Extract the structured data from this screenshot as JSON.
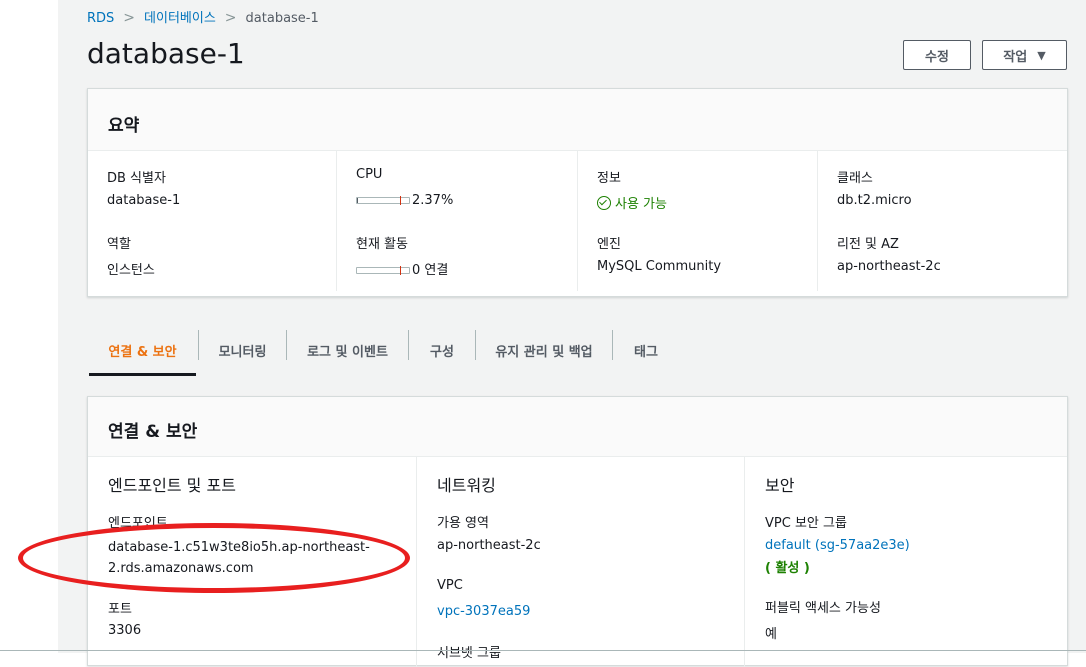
{
  "breadcrumb": {
    "root": "RDS",
    "parent": "데이터베이스",
    "current": "database-1"
  },
  "page": {
    "title": "database-1"
  },
  "actions": {
    "edit_label": "수정",
    "actions_label": "작업",
    "actions_caret": "▼"
  },
  "summary": {
    "title": "요약",
    "db_identifier": {
      "label": "DB 식별자",
      "value": "database-1"
    },
    "cpu": {
      "label": "CPU",
      "value": "2.37%",
      "meter_fraction": 0.0237
    },
    "info": {
      "label": "정보",
      "value": "사용 가능"
    },
    "class": {
      "label": "클래스",
      "value": "db.t2.micro"
    },
    "role": {
      "label": "역할",
      "value": "인스턴스"
    },
    "activity": {
      "label": "현재 활동",
      "value": "0 연결",
      "meter_fraction": 0
    },
    "engine": {
      "label": "엔진",
      "value": "MySQL Community"
    },
    "region": {
      "label": "리전 및 AZ",
      "value": "ap-northeast-2c"
    }
  },
  "tabs": [
    {
      "label": "연결 & 보안",
      "active": true
    },
    {
      "label": "모니터링"
    },
    {
      "label": "로그 및 이벤트"
    },
    {
      "label": "구성"
    },
    {
      "label": "유지 관리 및 백업"
    },
    {
      "label": "태그"
    }
  ],
  "connectivity": {
    "title": "연결 & 보안",
    "endpoint_section": {
      "title": "엔드포인트 및 포트",
      "endpoint_label": "엔드포인트",
      "endpoint_value": "database-1.c51w3te8io5h.ap-northeast-2.rds.amazonaws.com",
      "endpoint_line1": "database-1.c51w3te8io5h.ap-northeast-",
      "endpoint_line2": "2.rds.amazonaws.com",
      "port_label": "포트",
      "port_value": "3306"
    },
    "network_section": {
      "title": "네트워킹",
      "az_label": "가용 영역",
      "az_value": "ap-northeast-2c",
      "vpc_label": "VPC",
      "vpc_value": "vpc-3037ea59",
      "subnet_label": "서브넷 그룹"
    },
    "security_section": {
      "title": "보안",
      "sg_label": "VPC 보안 그룹",
      "sg_value": "default (sg-57aa2e3e)",
      "sg_status": "( 활성 )",
      "public_label": "퍼블릭 액세스 가능성",
      "public_value": "예"
    }
  },
  "colors": {
    "link": "#0073bb",
    "active_tab": "#ec7211",
    "success": "#1d8102",
    "annotation": "#e81f1f"
  },
  "icons": {
    "status": "check-circle-icon",
    "actions_caret": "caret-down-icon",
    "breadcrumb_sep": "chevron-right-icon"
  }
}
